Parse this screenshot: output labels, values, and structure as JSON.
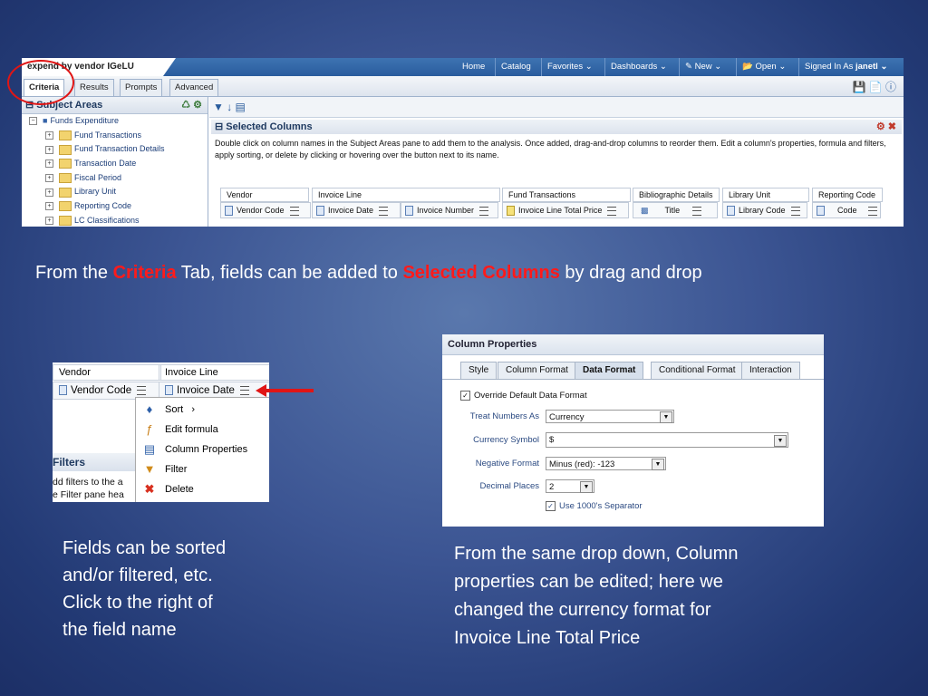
{
  "shot1": {
    "app_title": "expend by vendor IGeLU",
    "nav": [
      "Home",
      "Catalog",
      "Favorites ⌄",
      "Dashboards ⌄",
      "New ⌄",
      "Open ⌄"
    ],
    "signed_in_label": "Signed In As",
    "user": "janetl ⌄",
    "tabs": [
      "Criteria",
      "Results",
      "Prompts",
      "Advanced"
    ],
    "subject_areas_title": "Subject Areas",
    "tree_root": "Funds Expenditure",
    "tree_items": [
      "Fund Transactions",
      "Fund Transaction Details",
      "Transaction Date",
      "Fiscal Period",
      "Library Unit",
      "Reporting Code",
      "LC Classifications"
    ],
    "selected_columns_title": "Selected Columns",
    "selected_columns_help": "Double click on column names in the Subject Areas pane to add them to the analysis. Once added, drag-and-drop columns to reorder them. Edit a column's properties, formula and filters, apply sorting, or delete by clicking or hovering over the button next to its name.",
    "groups": [
      "Vendor",
      "Invoice Line",
      "Fund Transactions",
      "Bibliographic Details",
      "Library Unit",
      "Reporting Code"
    ],
    "columns": [
      "Vendor Code",
      "Invoice Date",
      "Invoice Number",
      "Invoice Line Total Price",
      "Title",
      "Library Code",
      "Code"
    ]
  },
  "caption1": {
    "part1": "From the ",
    "criteria": "Criteria",
    "part2": " Tab, fields can be added to ",
    "selected": "Selected Columns",
    "part3": " by drag and drop"
  },
  "shot2": {
    "group_vendor": "Vendor",
    "group_invoice_line": "Invoice Line",
    "col_vendor_code": "Vendor Code",
    "col_invoice_date": "Invoice Date",
    "menu": [
      "Sort",
      "Edit formula",
      "Column Properties",
      "Filter",
      "Delete"
    ],
    "sort_arrow": "›",
    "filters_title": "Filters",
    "filters_text1": "dd filters to the a",
    "filters_text2": "e Filter pane hea"
  },
  "caption2": {
    "lines": [
      "Fields can be sorted",
      "and/or filtered, etc.",
      "Click to the right of",
      "the field name"
    ]
  },
  "shot3": {
    "title": "Column Properties",
    "tabs": [
      "Style",
      "Column Format",
      "Data Format",
      "Conditional Format",
      "Interaction"
    ],
    "override_label": "Override Default Data Format",
    "treat_label": "Treat Numbers As",
    "treat_value": "Currency",
    "symbol_label": "Currency Symbol",
    "symbol_value": "$",
    "negative_label": "Negative Format",
    "negative_value": "Minus (red): -123",
    "decimal_label": "Decimal Places",
    "decimal_value": "2",
    "separator_label": "Use 1000's Separator"
  },
  "caption3": {
    "lines": [
      "From the same drop down, Column",
      "properties can be edited; here we",
      "changed the currency format for",
      "Invoice Line Total Price"
    ]
  }
}
